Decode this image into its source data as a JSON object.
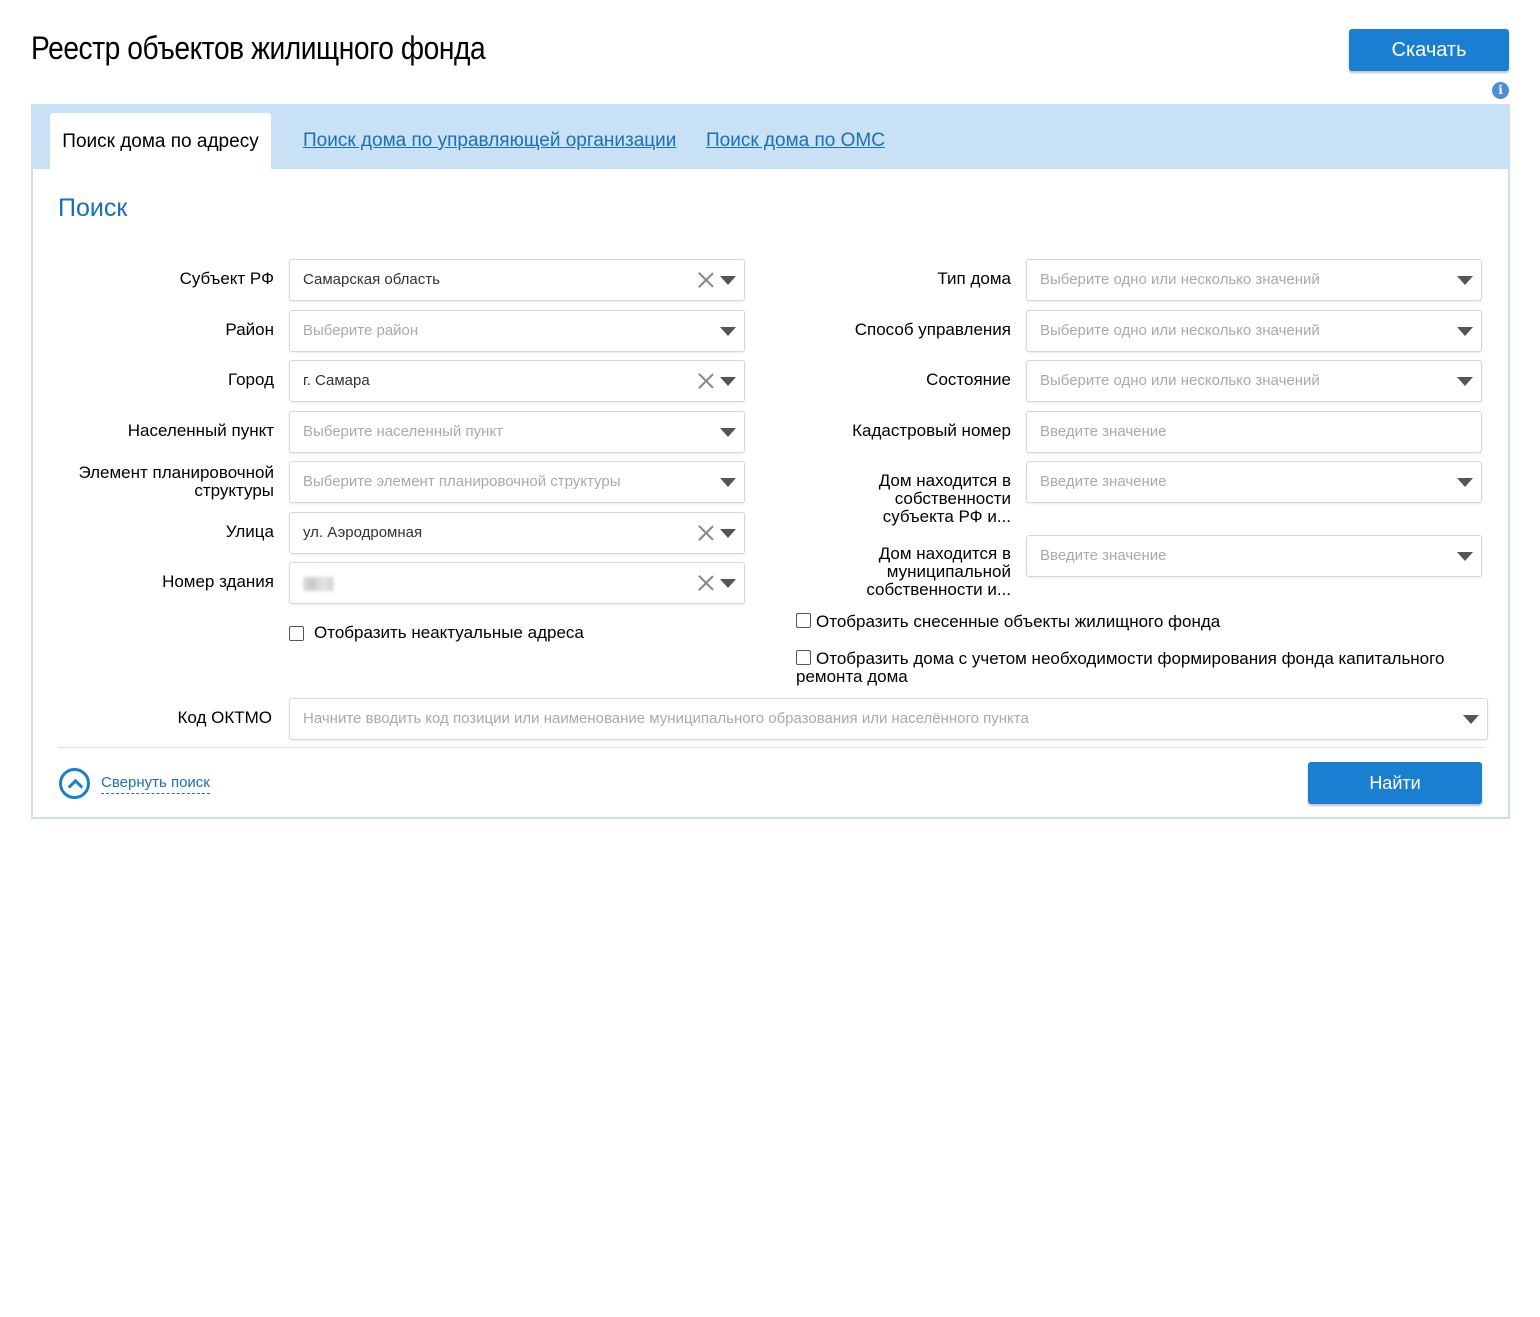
{
  "header": {
    "title": "Реестр объектов жилищного фонда",
    "download_label": "Скачать",
    "info_icon": "i"
  },
  "tabs": [
    {
      "label": "Поиск дома по адресу",
      "active": true
    },
    {
      "label": "Поиск дома по управляющей организации",
      "active": false
    },
    {
      "label": "Поиск дома по ОМС",
      "active": false
    }
  ],
  "search": {
    "title": "Поиск",
    "left": {
      "subject": {
        "label": "Субъект РФ",
        "value": "Самарская область"
      },
      "district": {
        "label": "Район",
        "placeholder": "Выберите район"
      },
      "city": {
        "label": "Город",
        "value": "г. Самара"
      },
      "settlement": {
        "label": "Населенный пункт",
        "placeholder": "Выберите населенный пункт"
      },
      "plan_element": {
        "label": "Элемент планировочной структуры",
        "placeholder": "Выберите элемент планировочной структуры"
      },
      "street": {
        "label": "Улица",
        "value": "ул. Аэродромная"
      },
      "building": {
        "label": "Номер здания"
      },
      "show_inactive": {
        "label": "Отобразить неактуальные адреса"
      }
    },
    "right": {
      "house_type": {
        "label": "Тип дома",
        "placeholder": "Выберите одно или несколько значений"
      },
      "management": {
        "label": "Способ управления",
        "placeholder": "Выберите одно или несколько значений"
      },
      "state": {
        "label": "Состояние",
        "placeholder": "Выберите одно или несколько значений"
      },
      "cadastral": {
        "label": "Кадастровый номер",
        "placeholder": "Введите значение"
      },
      "subject_property": {
        "label": "Дом находится в собственности субъекта РФ и...",
        "placeholder": "Введите значение"
      },
      "municipal_property": {
        "label": "Дом находится в муниципальной собственности и...",
        "placeholder": "Введите значение"
      },
      "show_demolished": {
        "label": "Отобразить снесенные объекты жилищного фонда"
      },
      "show_capital_repair": {
        "label": "Отобразить дома с учетом необходимости формирования фонда капитального ремонта дома"
      }
    },
    "oktmo": {
      "label": "Код ОКТМО",
      "placeholder": "Начните вводить код позиции или наименование муниципального образования или населённого пункта"
    },
    "collapse_label": "Свернуть поиск",
    "find_label": "Найти"
  }
}
